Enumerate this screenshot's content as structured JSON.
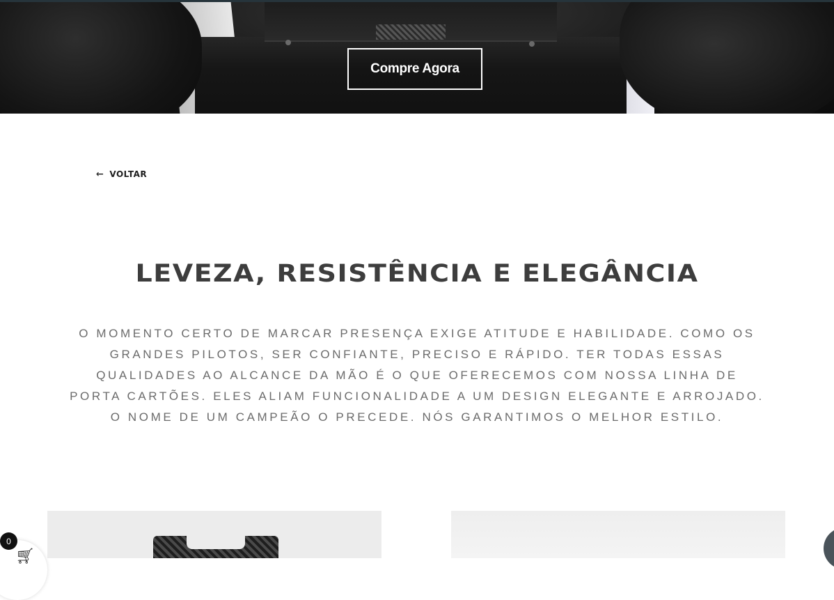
{
  "hero": {
    "cta_label": "Compre Agora"
  },
  "nav": {
    "back_label": "VOLTAR",
    "back_icon": "arrow-left-icon"
  },
  "section": {
    "title": "LEVEZA, RESISTÊNCIA E ELEGÂNCIA",
    "description": "O MOMENTO CERTO DE MARCAR PRESENÇA EXIGE ATITUDE E HABILIDADE. COMO OS GRANDES PILOTOS, SER CONFIANTE, PRECISO E RÁPIDO. TER TODAS ESSAS QUALIDADES AO ALCANCE DA MÃO É O QUE OFERECEMOS COM NOSSA LINHA DE PORTA CARTÕES. ELES ALIAM FUNCIONALIDADE A UM DESIGN ELEGANTE E ARROJADO. O NOME DE UM CAMPEÃO O PRECEDE. NÓS GARANTIMOS O MELHOR ESTILO."
  },
  "cart": {
    "count": "0",
    "icon": "cart-icon"
  },
  "colors": {
    "title": "#3d3d3d",
    "description": "#6b6b6b",
    "chat_button": "#4a535a"
  }
}
